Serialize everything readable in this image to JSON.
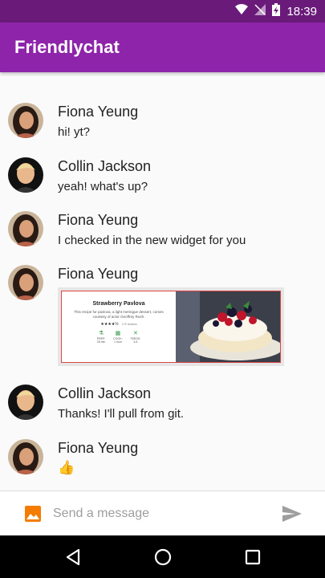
{
  "status_bar": {
    "time": "18:39"
  },
  "app_bar": {
    "title": "Friendlychat"
  },
  "messages": [
    {
      "sender": "Fiona Yeung",
      "text": "hi! yt?"
    },
    {
      "sender": "Collin Jackson",
      "text": "yeah! what's up?"
    },
    {
      "sender": "Fiona Yeung",
      "text": "I checked in the new widget for you"
    },
    {
      "sender": "Fiona Yeung",
      "recipe": {
        "title": "Strawberry Pavlova",
        "description": "This recipe for pavlova, a light meringue dessert, comes courtesy of actor Geoffrey Rush.",
        "rating": "★★★★½",
        "reviews": "170 reviews",
        "stats": [
          {
            "label": "PREP:",
            "value": "25 min"
          },
          {
            "label": "COOK:",
            "value": "1 hour"
          },
          {
            "label": "FEEDS:",
            "value": "4-6"
          }
        ]
      }
    },
    {
      "sender": "Collin Jackson",
      "text": "Thanks! I'll pull from git."
    },
    {
      "sender": "Fiona Yeung",
      "text": "👍"
    }
  ],
  "composer": {
    "placeholder": "Send a message"
  },
  "icons": {
    "gallery": "image-icon",
    "send": "send-icon",
    "back": "back-icon",
    "home": "home-icon",
    "recents": "recents-icon"
  },
  "colors": {
    "status_bar": "#6a1b7a",
    "app_bar": "#8e24aa",
    "gallery_icon": "#f57c00",
    "send_icon": "#9e9e9e"
  }
}
